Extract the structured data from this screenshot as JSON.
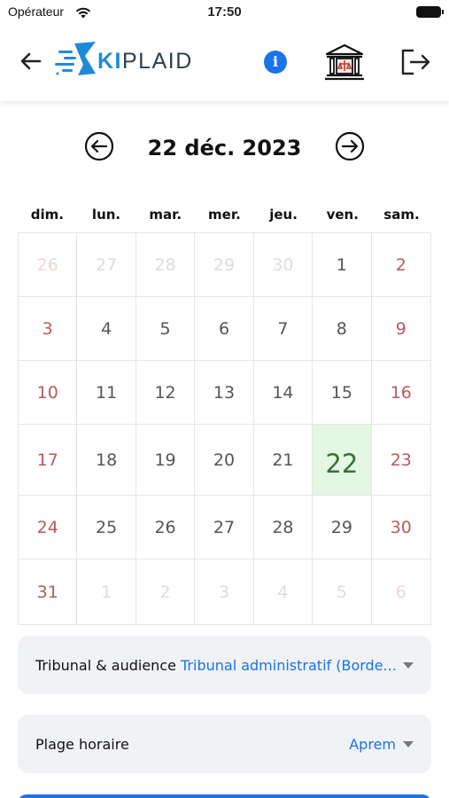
{
  "status_bar": {
    "carrier": "Opérateur",
    "time": "17:50"
  },
  "header": {
    "logo_ki": "KI",
    "logo_plaid": "PLAID",
    "info_label": "i",
    "icons": [
      "back-arrow-icon",
      "info-icon",
      "courthouse-icon",
      "logout-icon"
    ]
  },
  "calendar": {
    "title": "22 déc. 2023",
    "weekdays": [
      "dim.",
      "lun.",
      "mar.",
      "mer.",
      "jeu.",
      "ven.",
      "sam."
    ],
    "days": [
      {
        "label": "26",
        "muted": true
      },
      {
        "label": "27",
        "muted": true
      },
      {
        "label": "28",
        "muted": true
      },
      {
        "label": "29",
        "muted": true
      },
      {
        "label": "30",
        "muted": true
      },
      {
        "label": "1"
      },
      {
        "label": "2"
      },
      {
        "label": "3"
      },
      {
        "label": "4"
      },
      {
        "label": "5"
      },
      {
        "label": "6"
      },
      {
        "label": "7"
      },
      {
        "label": "8"
      },
      {
        "label": "9"
      },
      {
        "label": "10"
      },
      {
        "label": "11"
      },
      {
        "label": "12"
      },
      {
        "label": "13"
      },
      {
        "label": "14"
      },
      {
        "label": "15"
      },
      {
        "label": "16"
      },
      {
        "label": "17"
      },
      {
        "label": "18"
      },
      {
        "label": "19"
      },
      {
        "label": "20"
      },
      {
        "label": "21"
      },
      {
        "label": "22",
        "selected": true
      },
      {
        "label": "23"
      },
      {
        "label": "24"
      },
      {
        "label": "25"
      },
      {
        "label": "26"
      },
      {
        "label": "27"
      },
      {
        "label": "28"
      },
      {
        "label": "29"
      },
      {
        "label": "30"
      },
      {
        "label": "31"
      },
      {
        "label": "1",
        "muted": true
      },
      {
        "label": "2",
        "muted": true
      },
      {
        "label": "3",
        "muted": true
      },
      {
        "label": "4",
        "muted": true
      },
      {
        "label": "5",
        "muted": true
      },
      {
        "label": "6",
        "muted": true
      }
    ]
  },
  "form": {
    "court_label": "Tribunal & audience",
    "court_value": "Tribunal administratif (Borde...",
    "slot_label": "Plage horaire",
    "slot_value": "Aprem"
  },
  "colors": {
    "accent": "#1a73e8",
    "weekend": "#b65b5b",
    "today_bg": "#e3f7e3"
  }
}
